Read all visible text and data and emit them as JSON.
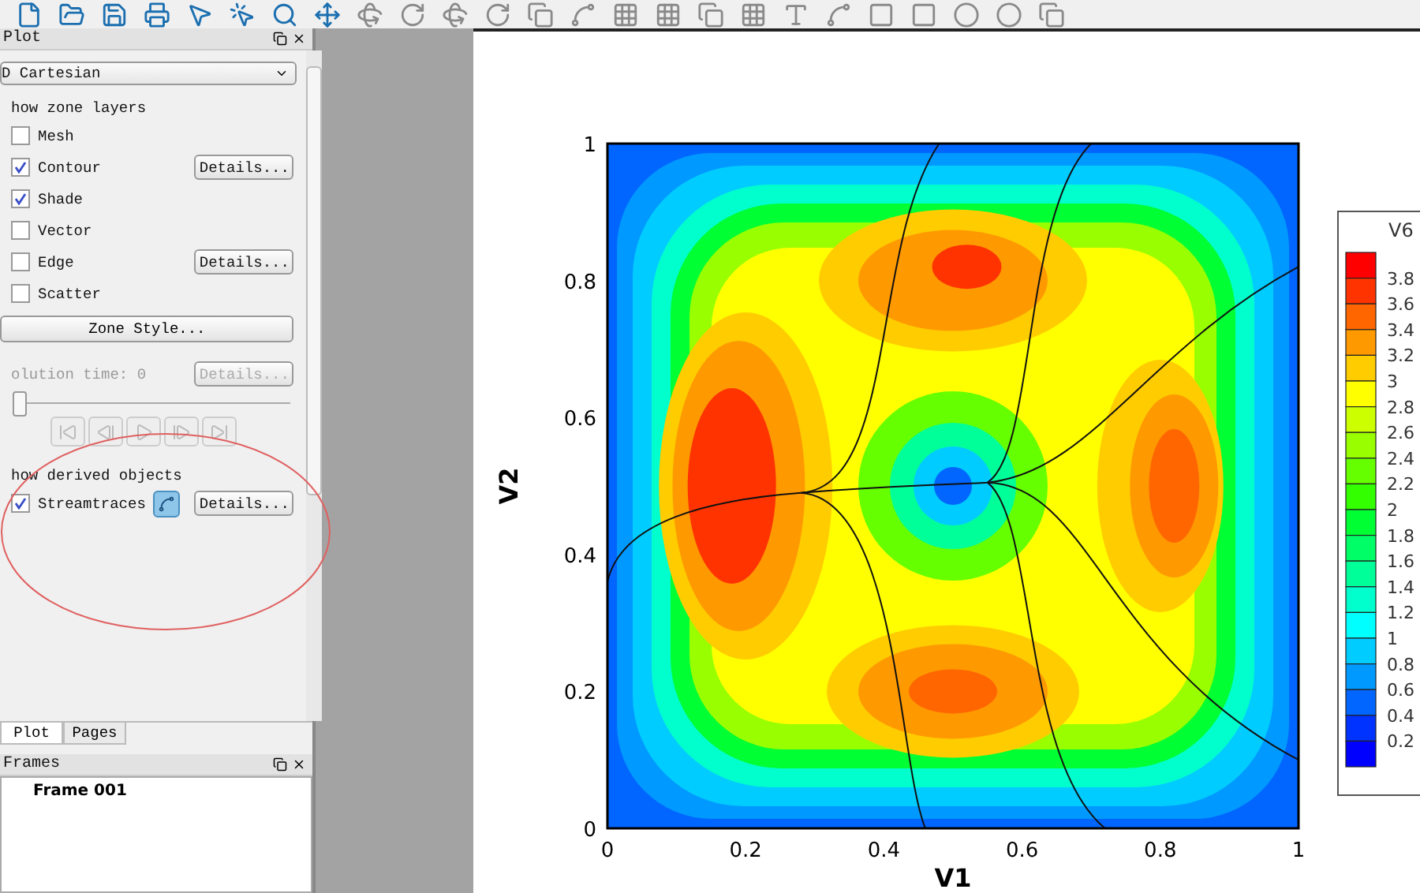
{
  "plot_panel": {
    "title": "Plot",
    "plot_type": "D Cartesian",
    "zone_layers_heading": "how zone layers",
    "layers": [
      {
        "label": "Mesh",
        "checked": false
      },
      {
        "label": "Contour",
        "checked": true,
        "details": "Details..."
      },
      {
        "label": "Shade",
        "checked": true
      },
      {
        "label": "Vector",
        "checked": false
      },
      {
        "label": "Edge",
        "checked": false,
        "details": "Details..."
      },
      {
        "label": "Scatter",
        "checked": false
      }
    ],
    "zone_style": "Zone Style...",
    "solution_time": {
      "label": "olution time: 0",
      "details": "Details...",
      "disabled": true
    },
    "time_slider": {
      "level": 0
    },
    "derived_heading": "how derived objects",
    "derived": [
      {
        "label": "Streamtraces",
        "checked": true,
        "details": "Details..."
      }
    ],
    "tabs": [
      {
        "label": "Plot",
        "selected": true
      },
      {
        "label": "Pages",
        "selected": false
      }
    ]
  },
  "frames_panel": {
    "title": "Frames",
    "items": [
      "Frame 001"
    ]
  },
  "plot": {
    "x_axis": {
      "title": "V1",
      "ticks": [
        "0",
        "0.2",
        "0.4",
        "0.6",
        "0.8",
        "1"
      ]
    },
    "y_axis": {
      "title": "V2",
      "ticks": [
        "1",
        "0.8",
        "0.6",
        "0.4",
        "0.2",
        "0"
      ]
    },
    "legend": {
      "title": "V6",
      "swatches": [
        {
          "color": "#ff0000"
        },
        {
          "color": "#ff3300"
        },
        {
          "color": "#ff6600"
        },
        {
          "color": "#ff9900"
        },
        {
          "color": "#ffcc00"
        },
        {
          "color": "#ffff00"
        },
        {
          "color": "#ccff00"
        },
        {
          "color": "#99ff00"
        },
        {
          "color": "#66ff00"
        },
        {
          "color": "#33ff00"
        },
        {
          "color": "#00ff33"
        },
        {
          "color": "#00ff66"
        },
        {
          "color": "#00ff99"
        },
        {
          "color": "#00ffcc"
        },
        {
          "color": "#00ffff"
        },
        {
          "color": "#00ccff"
        },
        {
          "color": "#0099ff"
        },
        {
          "color": "#0066ff"
        },
        {
          "color": "#0033ff"
        },
        {
          "color": "#0000ff"
        }
      ],
      "labels": [
        "3.8",
        "3.6",
        "3.4",
        "3.2",
        "3",
        "2.8",
        "2.6",
        "2.4",
        "2.2",
        "2",
        "1.8",
        "1.6",
        "1.4",
        "1.2",
        "1",
        "0.8",
        "0.6",
        "0.4",
        "0.2"
      ]
    }
  }
}
